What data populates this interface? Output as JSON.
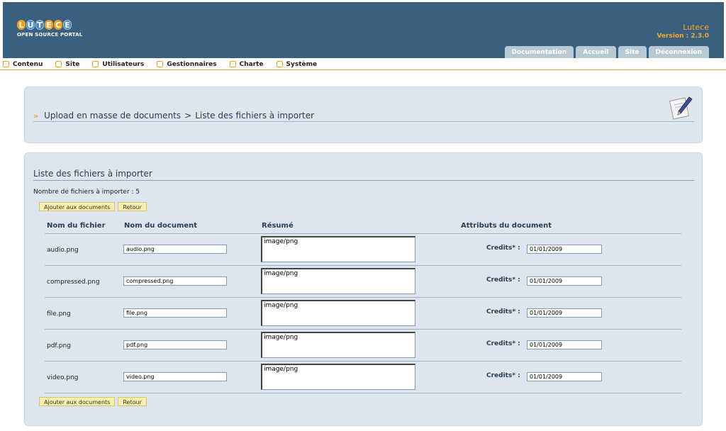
{
  "header": {
    "logo_letters": [
      "L",
      "U",
      "T",
      "E",
      "C",
      "E"
    ],
    "logo_subtitle": "OPEN SOURCE PORTAL",
    "site_name": "Lutece",
    "version": "Version : 2.3.0",
    "tabs": [
      "Documentation",
      "Accueil",
      "Site",
      "Déconnexion"
    ]
  },
  "menu": {
    "items": [
      "Contenu",
      "Site",
      "Utilisateurs",
      "Gestionnaires",
      "Charte",
      "Système"
    ]
  },
  "page": {
    "breadcrumb_part1": "Upload en masse de documents",
    "breadcrumb_sep": ">",
    "breadcrumb_part2": "Liste des fichiers à importer",
    "list_title": "Liste des fichiers à importer",
    "count_text": "Nombre de fichiers à importer : 5",
    "add_button": "Ajouter aux documents",
    "back_button": "Retour"
  },
  "table": {
    "headers": [
      "Nom du fichier",
      "Nom du document",
      "Résumé",
      "Attributs du document"
    ],
    "rows": [
      {
        "file": "audio.png",
        "document": "audio.png",
        "summary": "image/png",
        "credits_label": "Credits* :",
        "credits": "01/01/2009"
      },
      {
        "file": "compressed.png",
        "document": "compressed.png",
        "summary": "image/png",
        "credits_label": "Credits* :",
        "credits": "01/01/2009"
      },
      {
        "file": "file.png",
        "document": "file.png",
        "summary": "image/png",
        "credits_label": "Credits* :",
        "credits": "01/01/2009"
      },
      {
        "file": "pdf.png",
        "document": "pdf.png",
        "summary": "image/png",
        "credits_label": "Credits* :",
        "credits": "01/01/2009"
      },
      {
        "file": "video.png",
        "document": "video.png",
        "summary": "image/png",
        "credits_label": "Credits* :",
        "credits": "01/01/2009"
      }
    ]
  },
  "colors": {
    "header_bg": "#3a6080",
    "accent": "#f0a020",
    "panel_bg": "#dde6ee"
  }
}
